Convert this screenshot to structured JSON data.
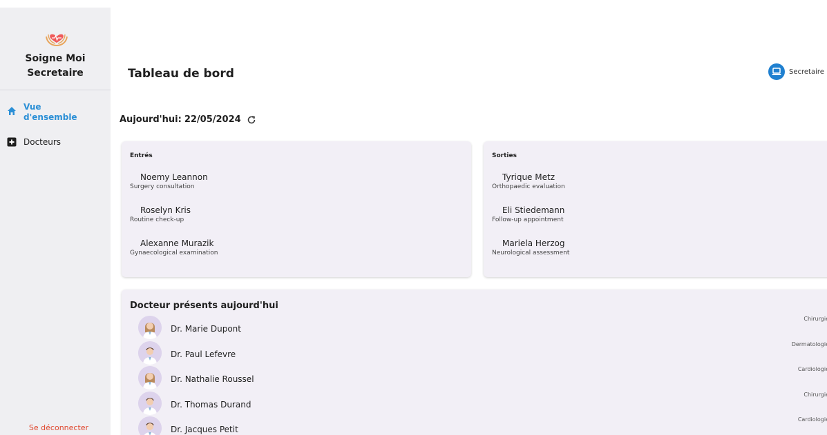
{
  "brand": {
    "line1": "Soigne Moi",
    "line2": "Secretaire"
  },
  "sidebar": {
    "items": [
      {
        "label_line1": "Vue",
        "label_line2": "d'ensemble",
        "icon": "home-icon",
        "active": true
      },
      {
        "label": "Docteurs",
        "icon": "plus-square-icon",
        "active": false
      }
    ],
    "logout": "Se déconnecter"
  },
  "header": {
    "title": "Tableau de bord",
    "user": "Secretaire"
  },
  "date": {
    "prefix": "Aujourd'hui:",
    "value": "22/05/2024"
  },
  "entries": {
    "title": "Entrés",
    "items": [
      {
        "name": "Noemy Leannon",
        "reason": "Surgery consultation"
      },
      {
        "name": "Roselyn Kris",
        "reason": "Routine check-up"
      },
      {
        "name": "Alexanne Murazik",
        "reason": "Gynaecological examination"
      }
    ]
  },
  "exits": {
    "title": "Sorties",
    "items": [
      {
        "name": "Tyrique Metz",
        "reason": "Orthopaedic evaluation"
      },
      {
        "name": "Eli Stiedemann",
        "reason": "Follow-up appointment"
      },
      {
        "name": "Mariela Herzog",
        "reason": "Neurological assessment"
      }
    ]
  },
  "doctors": {
    "title": "Docteur présents aujourd'hui",
    "items": [
      {
        "name": "Dr. Marie Dupont",
        "specialty": "Chirurgie",
        "gender": "female"
      },
      {
        "name": "Dr. Paul Lefevre",
        "specialty": "Dermatologie",
        "gender": "male"
      },
      {
        "name": "Dr. Nathalie Roussel",
        "specialty": "Cardiologie",
        "gender": "female"
      },
      {
        "name": "Dr. Thomas Durand",
        "specialty": "Chirurgie",
        "gender": "male"
      },
      {
        "name": "Dr. Jacques Petit",
        "specialty": "Cardiologie",
        "gender": "male"
      }
    ]
  },
  "colors": {
    "accent": "#2b8fd6",
    "logout": "#e0482f",
    "card": "#f2eff6",
    "sidebar": "#efeff2"
  }
}
